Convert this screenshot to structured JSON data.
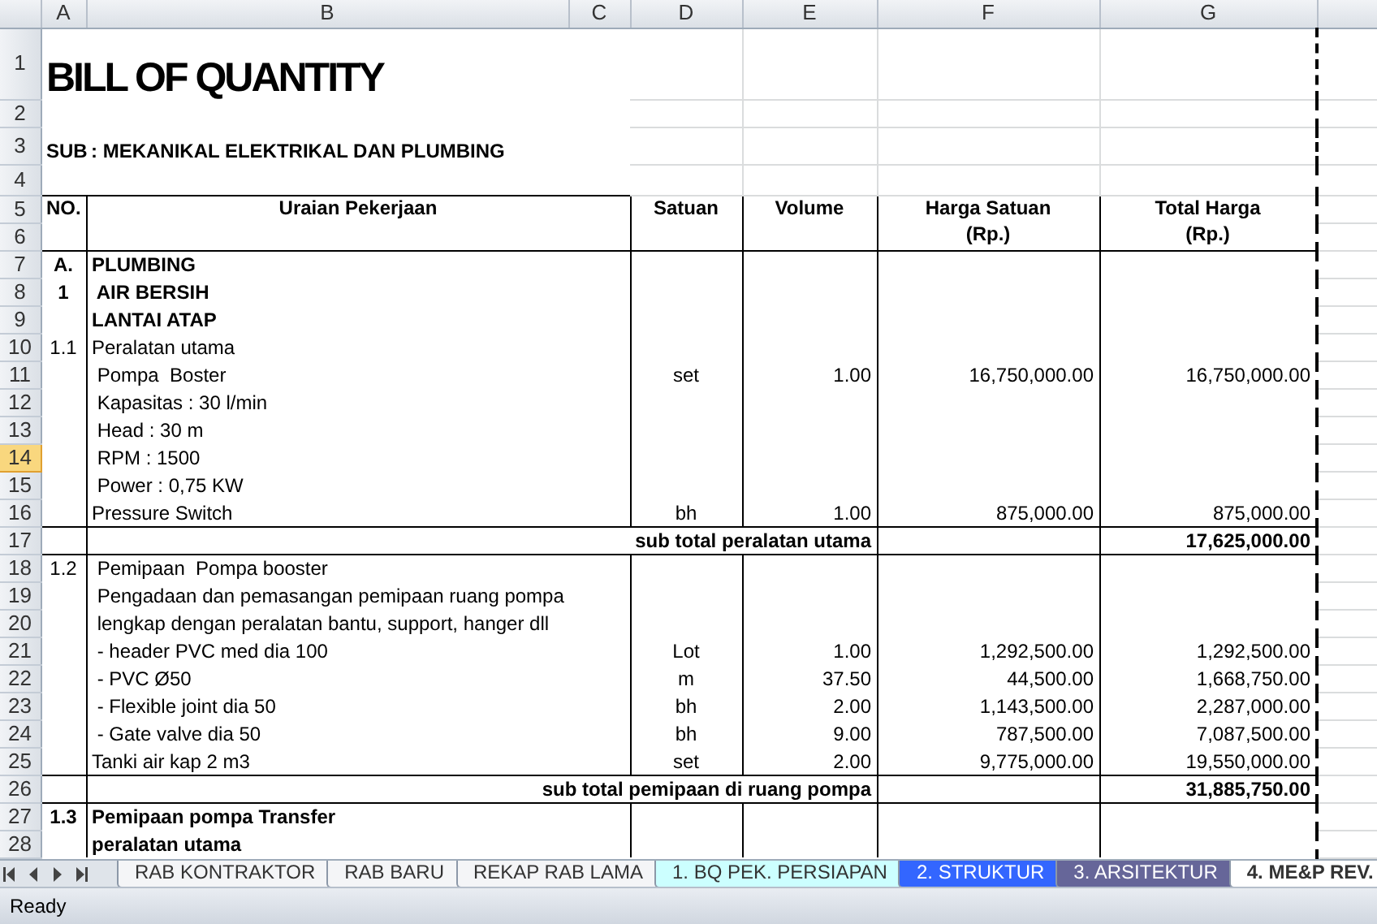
{
  "columns": [
    "A",
    "B",
    "C",
    "D",
    "E",
    "F",
    "G"
  ],
  "rows": [
    {
      "number": "1",
      "selected": false,
      "kind": "title",
      "description": "BILL OF QUANTITY"
    },
    {
      "number": "2",
      "selected": false,
      "kind": "blank"
    },
    {
      "number": "3",
      "selected": false,
      "kind": "subtitle",
      "no": "SUB",
      "description": ": MEKANIKAL ELEKTRIKAL DAN PLUMBING"
    },
    {
      "number": "4",
      "selected": false,
      "kind": "blank"
    },
    {
      "number": "5",
      "selected": false,
      "kind": "header",
      "no": "NO.",
      "description": "Uraian Pekerjaan",
      "unit": "Satuan",
      "volume": "Volume",
      "unit_price": "Harga Satuan",
      "total": "Total Harga"
    },
    {
      "number": "6",
      "selected": false,
      "kind": "header_end",
      "unit_price": "(Rp.)",
      "total": "(Rp.)"
    },
    {
      "number": "7",
      "selected": false,
      "kind": "section",
      "no": "A.",
      "description": "PLUMBING"
    },
    {
      "number": "8",
      "selected": false,
      "kind": "section",
      "no": "1",
      "description": " AIR BERSIH"
    },
    {
      "number": "9",
      "selected": false,
      "kind": "section",
      "description": "LANTAI ATAP"
    },
    {
      "number": "10",
      "selected": false,
      "kind": "item",
      "no": "1.1",
      "description": "Peralatan utama"
    },
    {
      "number": "11",
      "selected": false,
      "kind": "item",
      "description": " Pompa  Boster",
      "unit": "set",
      "volume": "1.00",
      "unit_price": "16,750,000.00",
      "total": "16,750,000.00"
    },
    {
      "number": "12",
      "selected": false,
      "kind": "item",
      "description": " Kapasitas : 30 l/min"
    },
    {
      "number": "13",
      "selected": false,
      "kind": "item",
      "description": " Head : 30 m"
    },
    {
      "number": "14",
      "selected": true,
      "kind": "item",
      "description": " RPM : 1500"
    },
    {
      "number": "15",
      "selected": false,
      "kind": "item",
      "description": " Power : 0,75 KW"
    },
    {
      "number": "16",
      "selected": false,
      "kind": "item",
      "description": "Pressure Switch",
      "unit": "bh",
      "volume": "1.00",
      "unit_price": "875,000.00",
      "total": "875,000.00"
    },
    {
      "number": "17",
      "selected": false,
      "kind": "subtotal",
      "description": "sub total peralatan utama",
      "total": "17,625,000.00"
    },
    {
      "number": "18",
      "selected": false,
      "kind": "item",
      "no": "1.2",
      "description": " Pemipaan  Pompa booster"
    },
    {
      "number": "19",
      "selected": false,
      "kind": "item",
      "description": " Pengadaan dan pemasangan pemipaan ruang pompa"
    },
    {
      "number": "20",
      "selected": false,
      "kind": "item",
      "description": " lengkap dengan peralatan bantu, support, hanger dll"
    },
    {
      "number": "21",
      "selected": false,
      "kind": "item",
      "description": " - header PVC med dia 100",
      "unit": "Lot",
      "volume": "1.00",
      "unit_price": "1,292,500.00",
      "total": "1,292,500.00"
    },
    {
      "number": "22",
      "selected": false,
      "kind": "item",
      "description": " - PVC Ø50",
      "unit": "m",
      "volume": "37.50",
      "unit_price": "44,500.00",
      "total": "1,668,750.00"
    },
    {
      "number": "23",
      "selected": false,
      "kind": "item",
      "description": " - Flexible joint dia 50",
      "unit": "bh",
      "volume": "2.00",
      "unit_price": "1,143,500.00",
      "total": "2,287,000.00"
    },
    {
      "number": "24",
      "selected": false,
      "kind": "item",
      "description": " - Gate valve dia 50",
      "unit": "bh",
      "volume": "9.00",
      "unit_price": "787,500.00",
      "total": "7,087,500.00"
    },
    {
      "number": "25",
      "selected": false,
      "kind": "item",
      "description": "Tanki air kap 2 m3",
      "unit": "set",
      "volume": "2.00",
      "unit_price": "9,775,000.00",
      "total": "19,550,000.00"
    },
    {
      "number": "26",
      "selected": false,
      "kind": "subtotal",
      "description": "sub total pemipaan di ruang pompa",
      "total": "31,885,750.00"
    },
    {
      "number": "27",
      "selected": false,
      "kind": "section",
      "no": "1.3",
      "description": "Pemipaan pompa Transfer"
    },
    {
      "number": "28",
      "selected": false,
      "kind": "section",
      "description": "peralatan utama"
    }
  ],
  "sheet_tabs": [
    {
      "label": "RAB KONTRAKTOR",
      "selected": false
    },
    {
      "label": "RAB BARU",
      "selected": false
    },
    {
      "label": "REKAP RAB LAMA",
      "selected": false
    },
    {
      "label": "1. BQ PEK. PERSIAPAN",
      "selected": false,
      "color": "#ccffff"
    },
    {
      "label": "2. STRUKTUR",
      "selected": false,
      "color": "#3366ff"
    },
    {
      "label": "3. ARSITEKTUR",
      "selected": false,
      "color": "#666699"
    },
    {
      "label": "4. ME&P REV.",
      "selected": true
    }
  ],
  "status_bar": {
    "text": "Ready"
  }
}
